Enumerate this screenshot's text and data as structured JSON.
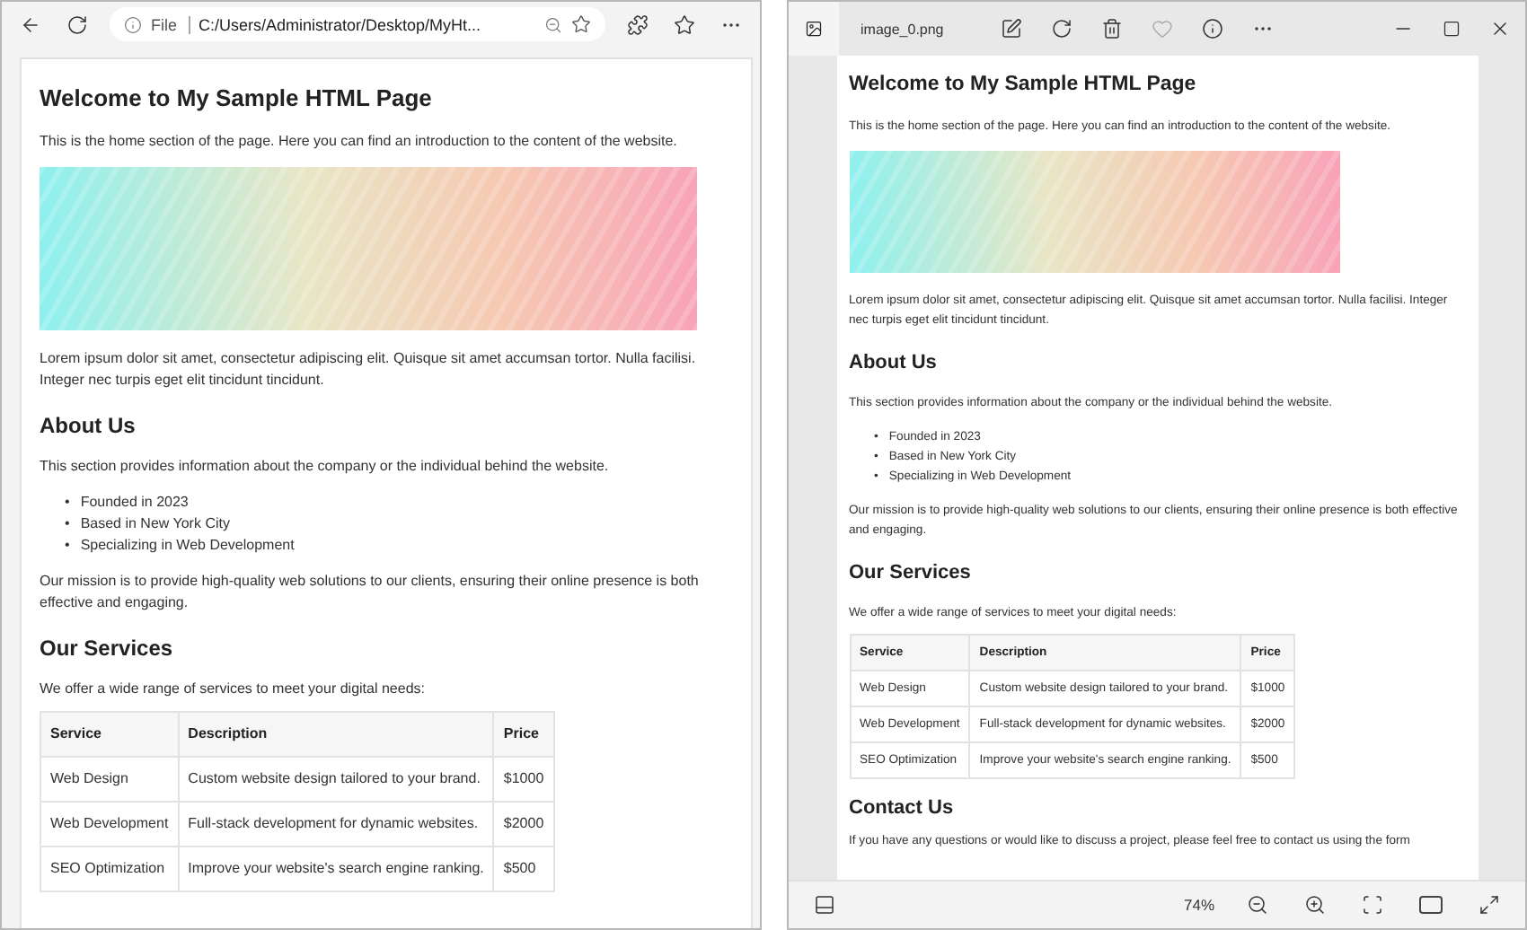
{
  "browser": {
    "address": {
      "scheme": "File",
      "url": "C:/Users/Administrator/Desktop/MyHt..."
    },
    "page": {
      "title": "Welcome to My Sample HTML Page",
      "intro": "This is the home section of the page. Here you can find an introduction to the content of the website.",
      "lorem": "Lorem ipsum dolor sit amet, consectetur adipiscing elit. Quisque sit amet accumsan tortor. Nulla facilisi. Integer nec turpis eget elit tincidunt tincidunt.",
      "about": {
        "heading": "About Us",
        "text": "This section provides information about the company or the individual behind the website.",
        "bullet": "•",
        "facts": [
          "Founded in 2023",
          "Based in New York City",
          "Specializing in Web Development"
        ],
        "mission": "Our mission is to provide high-quality web solutions to our clients, ensuring their online presence is both effective and engaging."
      },
      "services": {
        "heading": "Our Services",
        "text": "We offer a wide range of services to meet your digital needs:",
        "columns": [
          "Service",
          "Description",
          "Price"
        ],
        "rows": [
          [
            "Web Design",
            "Custom website design tailored to your brand.",
            "$1000"
          ],
          [
            "Web Development",
            "Full-stack development for dynamic websites.",
            "$2000"
          ],
          [
            "SEO Optimization",
            "Improve your website's search engine ranking.",
            "$500"
          ]
        ]
      }
    }
  },
  "viewer": {
    "title": "image_0.png",
    "page": {
      "title": "Welcome to My Sample HTML Page",
      "intro": "This is the home section of the page. Here you can find an introduction to the content of the website.",
      "lorem": "Lorem ipsum dolor sit amet, consectetur adipiscing elit. Quisque sit amet accumsan tortor. Nulla facilisi. Integer nec turpis eget elit tincidunt tincidunt.",
      "about": {
        "heading": "About Us",
        "text": "This section provides information about the company or the individual behind the website.",
        "bullet": "•",
        "facts": [
          "Founded in 2023",
          "Based in New York City",
          "Specializing in Web Development"
        ],
        "mission": "Our mission is to provide high-quality web solutions to our clients, ensuring their online presence is both effective and engaging."
      },
      "services": {
        "heading": "Our Services",
        "text": "We offer a wide range of services to meet your digital needs:",
        "columns": [
          "Service",
          "Description",
          "Price"
        ],
        "rows": [
          [
            "Web Design",
            "Custom website design tailored to your brand.",
            "$1000"
          ],
          [
            "Web Development",
            "Full-stack development for dynamic websites.",
            "$2000"
          ],
          [
            "SEO Optimization",
            "Improve your website's search engine ranking.",
            "$500"
          ]
        ]
      },
      "contact": {
        "heading": "Contact Us",
        "text": "If you have any questions or would like to discuss a project, please feel free to contact us using the form"
      }
    },
    "zoom": "74%"
  }
}
